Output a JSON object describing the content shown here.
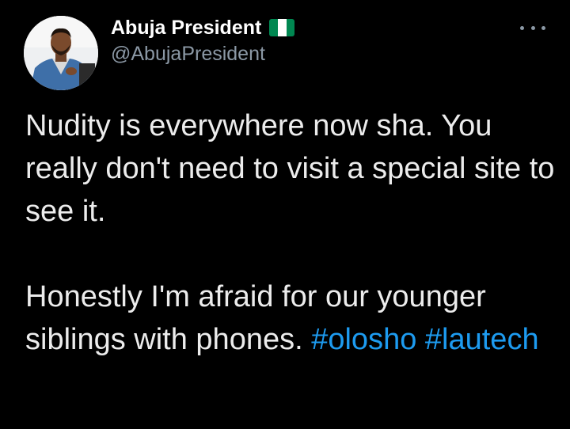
{
  "author": {
    "display_name": "Abuja President",
    "handle": "@AbujaPresident",
    "avatar_icon": "profile-photo",
    "badge_icon": "nigeria-flag-icon",
    "flag_colors": [
      "#008751",
      "#ffffff",
      "#008751"
    ]
  },
  "menu": {
    "icon": "more-horizontal-icon"
  },
  "tweet": {
    "paragraph_1": "Nudity is everywhere now sha. You really don't need to visit a special site to see it.",
    "paragraph_2_text": "Honestly I'm afraid for our younger siblings with phones.",
    "hashtag_1": "#olosho",
    "hashtag_2": "#lautech"
  },
  "theme": {
    "background": "#000000",
    "text": "#e7e9ea",
    "secondary_text": "#8b98a5",
    "link": "#1d9bf0"
  }
}
